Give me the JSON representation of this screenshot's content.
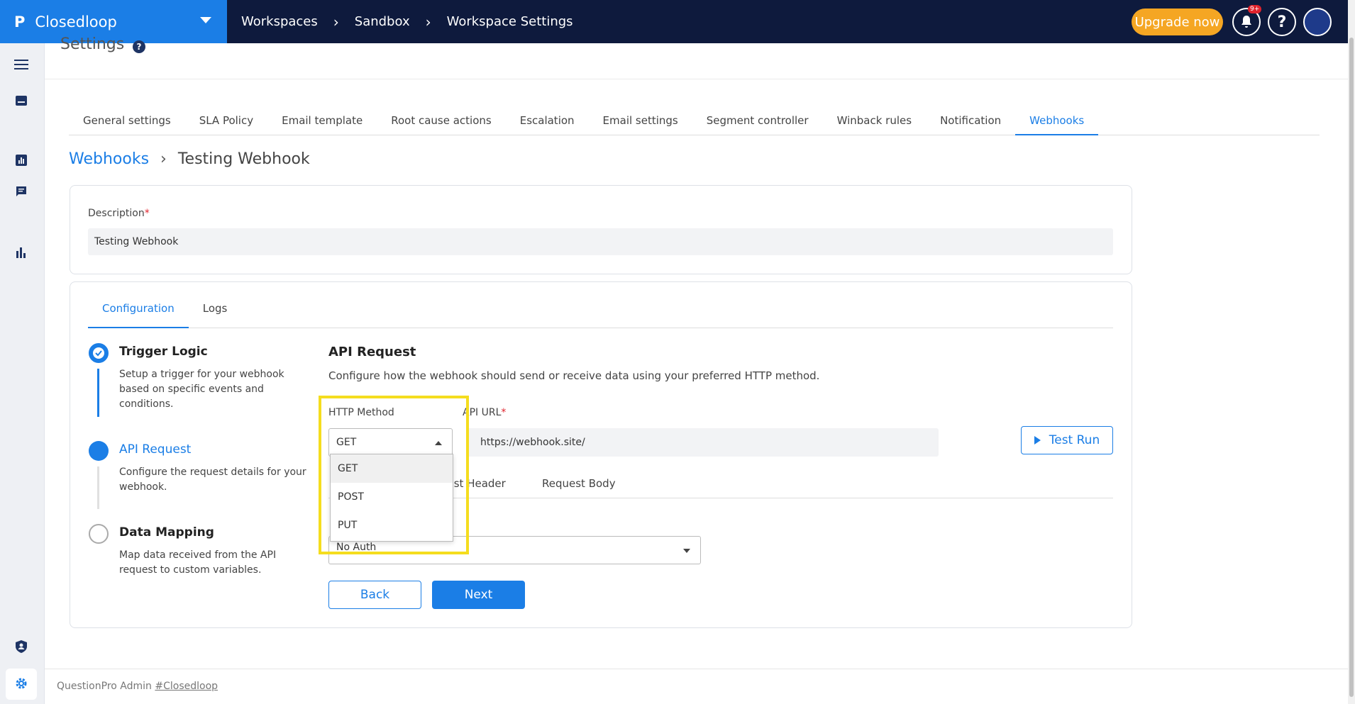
{
  "topbar": {
    "logo_glyph": "P",
    "app_name": "Closedloop",
    "breadcrumbs": [
      "Workspaces",
      "Sandbox",
      "Workspace Settings"
    ],
    "breadcrumb_sep": "›",
    "upgrade_label": "Upgrade now",
    "notif_badge": "9+",
    "help_glyph": "?",
    "accent": "#1b7ee6",
    "bg": "#0e1a3d",
    "upgrade_color": "#f5a623"
  },
  "sidebar": {
    "icons": [
      "menu-icon",
      "inbox-icon",
      "report-icon",
      "chat-icon",
      "bar-chart-icon",
      "shield-user-icon",
      "gear-icon"
    ]
  },
  "page": {
    "title": "Settings",
    "help_glyph": "?",
    "tabs": [
      "General settings",
      "SLA Policy",
      "Email template",
      "Root cause actions",
      "Escalation",
      "Email settings",
      "Segment controller",
      "Winback rules",
      "Notification",
      "Webhooks"
    ],
    "active_tab": "Webhooks",
    "breadcrumb": {
      "parent": "Webhooks",
      "sep": "›",
      "current": "Testing Webhook"
    }
  },
  "description": {
    "label": "Description",
    "required_mark": "*",
    "value": "Testing Webhook"
  },
  "config": {
    "tabs": [
      "Configuration",
      "Logs"
    ],
    "active_tab": "Configuration",
    "steps": [
      {
        "title": "Trigger Logic",
        "desc": "Setup a trigger for your webhook based on specific events and conditions.",
        "state": "completed"
      },
      {
        "title": "API Request",
        "desc": "Configure the request details for your webhook.",
        "state": "active"
      },
      {
        "title": "Data Mapping",
        "desc": "Map data received from the API request to custom variables.",
        "state": "pending"
      }
    ],
    "api": {
      "title": "API Request",
      "subtitle": "Configure how the webhook should send or receive data using your preferred HTTP method.",
      "method_label": "HTTP Method",
      "method_value": "GET",
      "url_label": "API URL",
      "url_label_visible": "API URL",
      "url_required_mark": "*",
      "url_value": "https://webhook.site/",
      "test_run_label": "Test Run",
      "request_tabs_visible": [
        "uest Header",
        "Request Body"
      ],
      "auth_value_visible": "No Auth",
      "back_label": "Back",
      "next_label": "Next"
    },
    "method_options": [
      "GET",
      "POST",
      "PUT"
    ],
    "method_options_highlighted": "GET"
  },
  "footer": {
    "text": "QuestionPro Admin",
    "link": "#Closedloop"
  }
}
